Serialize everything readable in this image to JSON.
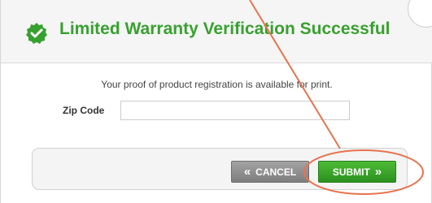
{
  "dialog": {
    "title": "Limited Warranty Verification Successful",
    "message": "Your proof of product registration is available for print."
  },
  "form": {
    "zip_label": "Zip Code",
    "zip_value": ""
  },
  "buttons": {
    "cancel_label": "CANCEL",
    "cancel_icon": "«",
    "submit_label": "SUBMIT",
    "submit_icon": "»"
  },
  "colors": {
    "accent_green": "#37a12f",
    "annotation": "#e8734e"
  }
}
